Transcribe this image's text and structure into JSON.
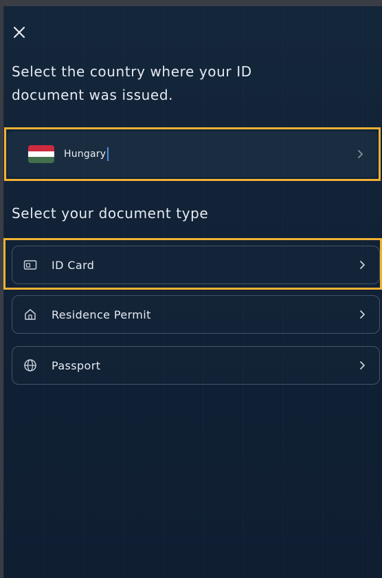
{
  "close": {
    "icon": "close-icon"
  },
  "country_section": {
    "heading": "Select the country where your ID document was issued.",
    "selected_country": "Hungary",
    "flag_colors": [
      "#cd2a3e",
      "#ffffff",
      "#436f4d"
    ]
  },
  "document_section": {
    "heading": "Select your document type",
    "options": [
      {
        "label": "ID Card",
        "icon": "id-card-icon"
      },
      {
        "label": "Residence Permit",
        "icon": "home-icon"
      },
      {
        "label": "Passport",
        "icon": "globe-icon"
      }
    ]
  },
  "colors": {
    "highlight": "#f2b233",
    "background": "#112236",
    "text": "#e6ebf2",
    "border": "#41546a"
  }
}
